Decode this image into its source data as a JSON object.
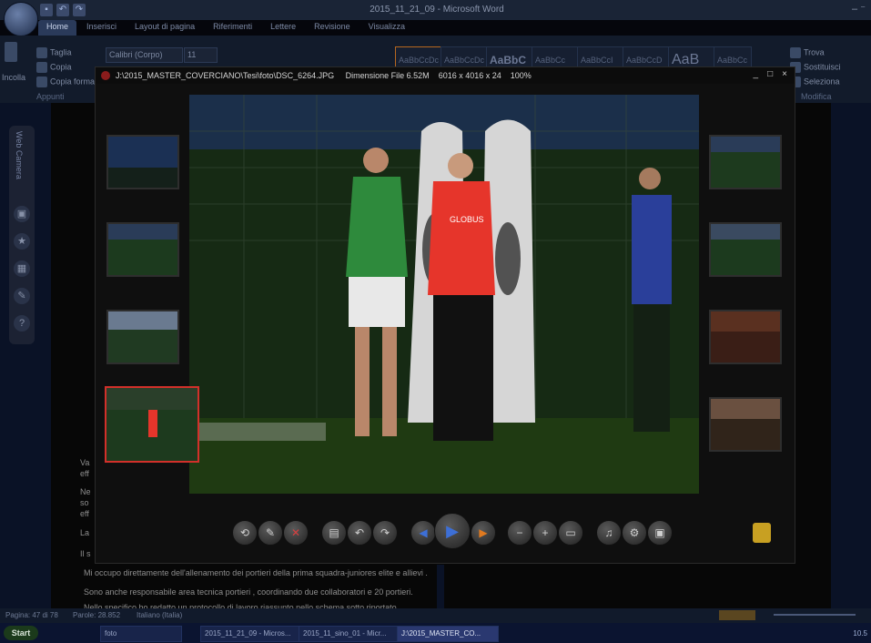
{
  "word": {
    "title": "2015_11_21_09 - Microsoft Word",
    "tabs": [
      "Home",
      "Inserisci",
      "Layout di pagina",
      "Riferimenti",
      "Lettere",
      "Revisione",
      "Visualizza"
    ],
    "clipboard": {
      "cut": "Taglia",
      "copy": "Copia",
      "paste": "Incolla",
      "format": "Copia formato",
      "group": "Appunti"
    },
    "font": {
      "name": "Calibri (Corpo)",
      "size": "11"
    },
    "styles": [
      "AaBbCcDc",
      "AaBbCcDc",
      "AaBbC",
      "AaBbCc",
      "AaBbCcI",
      "AaBbCcD",
      "AaB",
      "AaBbCc"
    ],
    "editing": {
      "find": "Trova",
      "replace": "Sostituisci",
      "select": "Seleziona",
      "group": "Modifica"
    },
    "side_panel_label": "Web Camera"
  },
  "document": {
    "lines": [
      "Va",
      "eff",
      "Ne",
      "so",
      "eff",
      "La",
      "Il s",
      "Mi occupo direttamente dell'allenamento  dei portieri della prima squadra-juniores elite e allievi .",
      "Sono anche responsabile area tecnica portieri  , coordinando due collaboratori e 20 portieri.",
      "Nello specifico ho redatto  un protocollo di lavoro  riassunto nello schema sotto riportato"
    ]
  },
  "viewer": {
    "path": "J:\\2015_MASTER_COVERCIANO\\Tesi\\foto\\DSC_6264.JPG",
    "filesize": "Dimensione File 6.52M",
    "dimensions": "6016 x 4016 x 24",
    "zoom": "100%",
    "controls": [
      "_",
      "□",
      "×"
    ],
    "toolbar_icons": [
      "rotate-icon",
      "edit-icon",
      "delete-icon",
      "save-icon",
      "undo-icon",
      "redo-icon",
      "prev-icon",
      "play-icon",
      "next-icon",
      "zoom-out-icon",
      "zoom-in-icon",
      "fit-icon",
      "music-icon",
      "settings-icon",
      "screen-icon"
    ],
    "shirt_text": "GLOBUS"
  },
  "status": {
    "page": "Pagina: 47 di 78",
    "words": "Parole: 28.852",
    "language": "Italiano (Italia)"
  },
  "taskbar": {
    "start": "Start",
    "items": [
      "foto",
      "2015_11_21_09 - Micros...",
      "2015_11_sino_01 - Micr...",
      "J:\\2015_MASTER_CO..."
    ],
    "time": "10.5"
  }
}
